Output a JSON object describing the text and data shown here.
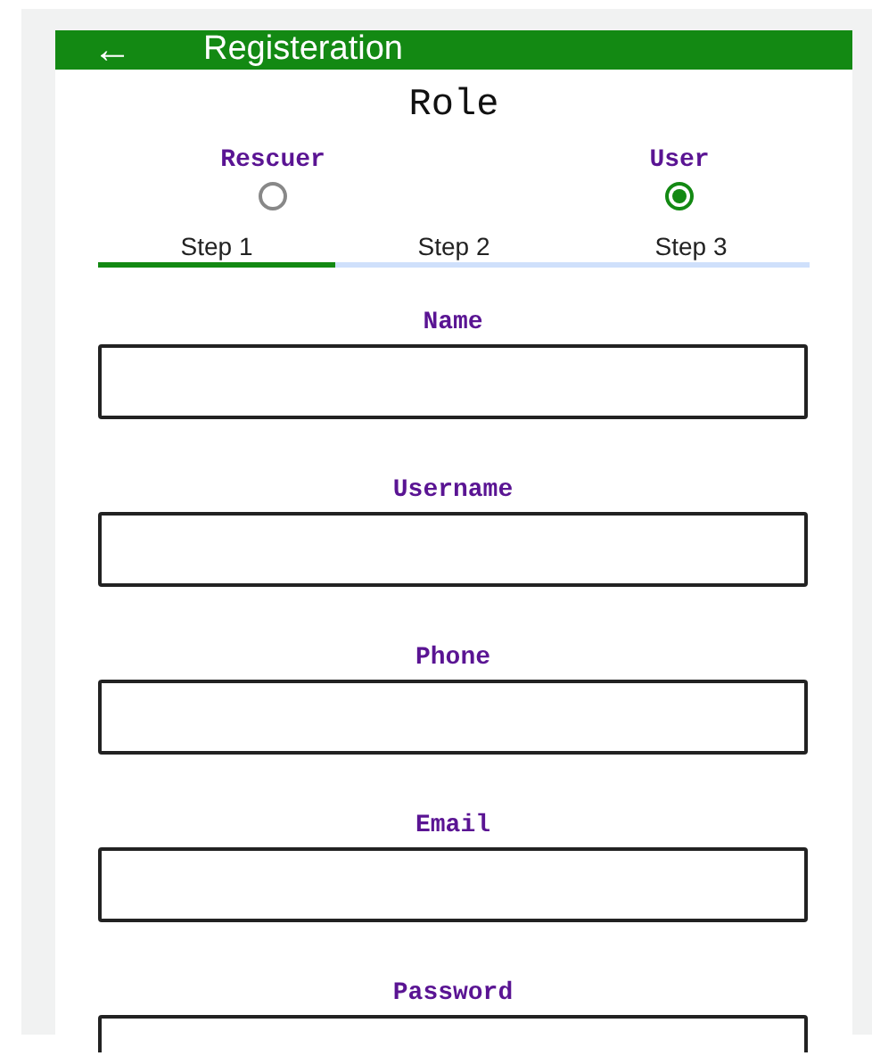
{
  "app_bar": {
    "back_icon": "←",
    "title": "Registeration"
  },
  "role": {
    "title": "Role",
    "options": [
      {
        "label": "Rescuer",
        "selected": false
      },
      {
        "label": "User",
        "selected": true
      }
    ]
  },
  "steps": [
    {
      "label": "Step 1",
      "selected": true
    },
    {
      "label": "Step 2",
      "selected": false
    },
    {
      "label": "Step 3",
      "selected": false
    }
  ],
  "fields": [
    {
      "label": "Name"
    },
    {
      "label": "Username"
    },
    {
      "label": "Phone"
    },
    {
      "label": "Email"
    },
    {
      "label": "Password"
    }
  ]
}
